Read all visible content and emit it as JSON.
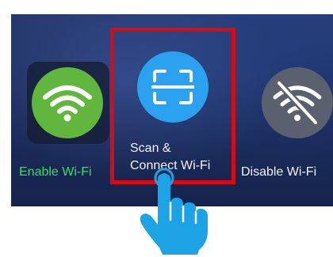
{
  "tiles": {
    "enable_wifi": {
      "label": "Enable Wi-Fi",
      "icon": "wifi-icon",
      "icon_color": "#61b63d",
      "label_color": "#2fe05a"
    },
    "scan_connect": {
      "label_line1": "Scan &",
      "label_line2": "Connect Wi-Fi",
      "icon": "qr-scan-icon",
      "icon_color": "#2aa2f0"
    },
    "disable_wifi": {
      "label": "Disable Wi-Fi",
      "icon": "wifi-off-icon",
      "icon_color": "#5a606e"
    }
  },
  "highlight": {
    "color": "#d90a12"
  },
  "pointer": {
    "icon": "pointing-hand-icon",
    "color": "#1ba3e6"
  }
}
